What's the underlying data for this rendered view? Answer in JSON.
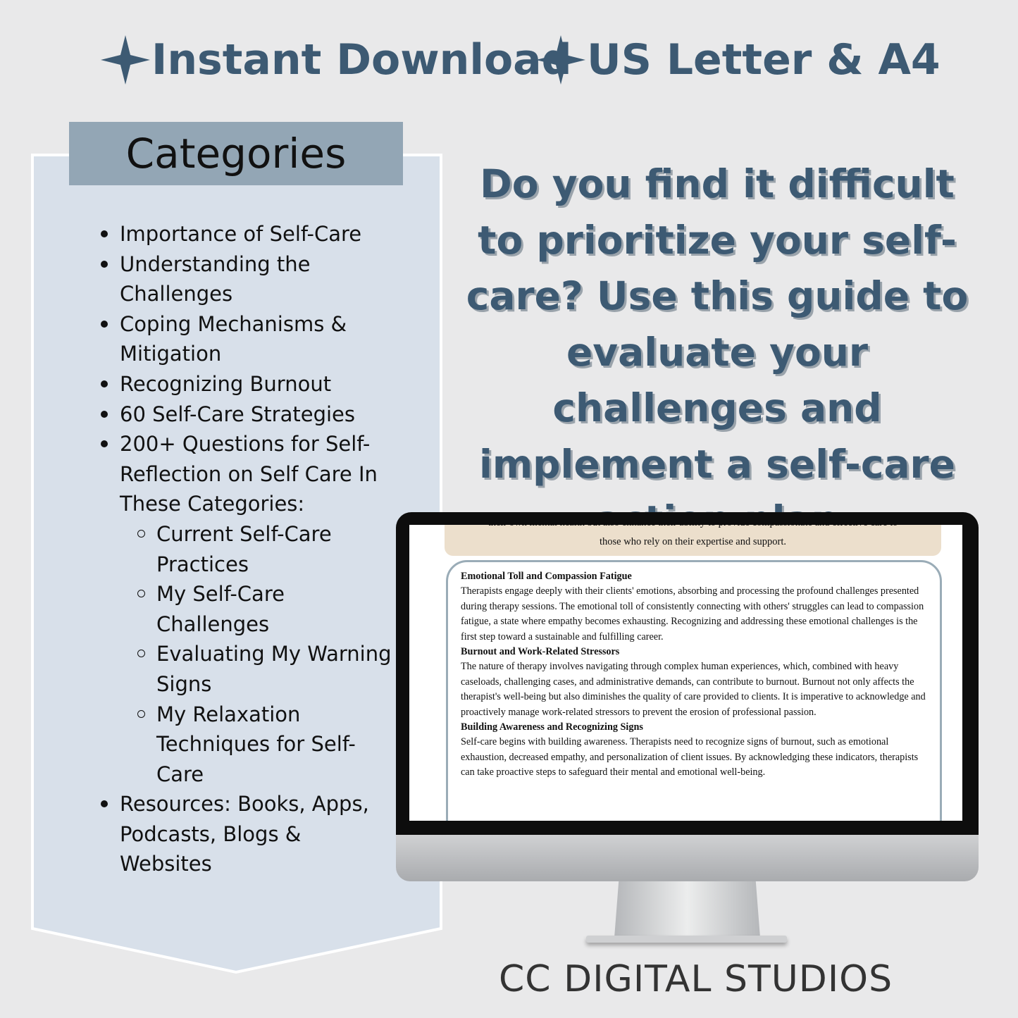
{
  "header": {
    "badges": [
      {
        "icon": "four-point-star-icon",
        "label": "Instant Download"
      },
      {
        "icon": "four-point-star-icon",
        "label": "US Letter & A4"
      }
    ]
  },
  "categories": {
    "title": "Categories",
    "items": [
      {
        "level": 1,
        "label": "Importance of Self-Care"
      },
      {
        "level": 1,
        "label": "Understanding the Challenges"
      },
      {
        "level": 1,
        "label": "Coping Mechanisms & Mitigation"
      },
      {
        "level": 1,
        "label": "Recognizing Burnout"
      },
      {
        "level": 1,
        "label": "60 Self-Care Strategies"
      },
      {
        "level": 1,
        "label": "200+ Questions for Self-Reflection on Self Care In These Categories:"
      },
      {
        "level": 2,
        "label": "Current Self-Care Practices"
      },
      {
        "level": 2,
        "label": "My Self-Care Challenges"
      },
      {
        "level": 2,
        "label": "Evaluating My Warning Signs"
      },
      {
        "level": 2,
        "label": "My Relaxation Techniques for Self-Care"
      },
      {
        "level": 1,
        "label": "Resources:  Books, Apps, Podcasts, Blogs & Websites"
      }
    ]
  },
  "headline": "Do you find it difficult to prioritize your self-care? Use this guide to evaluate your challenges and implement a self-care action plan",
  "screen": {
    "callout_cut": "their own mental health but also enhance their ability to provide compassionate and effective care to",
    "callout": "those who rely on their expertise and support.",
    "sections": [
      {
        "heading": "Emotional Toll and Compassion Fatigue",
        "body": "Therapists engage deeply with their clients' emotions, absorbing and processing the profound challenges presented during therapy sessions. The emotional toll of consistently connecting with others' struggles can lead to compassion fatigue, a state where empathy becomes exhausting. Recognizing and addressing these emotional challenges is the first step toward a sustainable and fulfilling career."
      },
      {
        "heading": "Burnout and Work-Related Stressors",
        "body": "The nature of therapy involves navigating through complex human experiences, which, combined with heavy caseloads, challenging cases, and administrative demands, can contribute to burnout. Burnout not only affects the therapist's well-being but also diminishes the quality of care provided to clients. It is imperative to acknowledge and proactively manage work-related stressors to prevent the erosion of professional passion."
      },
      {
        "heading": "Building Awareness and Recognizing Signs",
        "body": "Self-care begins with building awareness. Therapists need to recognize signs of burnout, such as emotional exhaustion, decreased empathy, and personalization of client issues. By acknowledging these indicators, therapists can take proactive steps to safeguard their mental and emotional well-being."
      }
    ]
  },
  "brand": "CC DIGITAL STUDIOS",
  "colors": {
    "accent": "#3d5a73",
    "panel": "#d8e0ea",
    "panel_header": "#93a6b5",
    "background": "#e9e9ea",
    "callout": "#ecdfcc"
  }
}
